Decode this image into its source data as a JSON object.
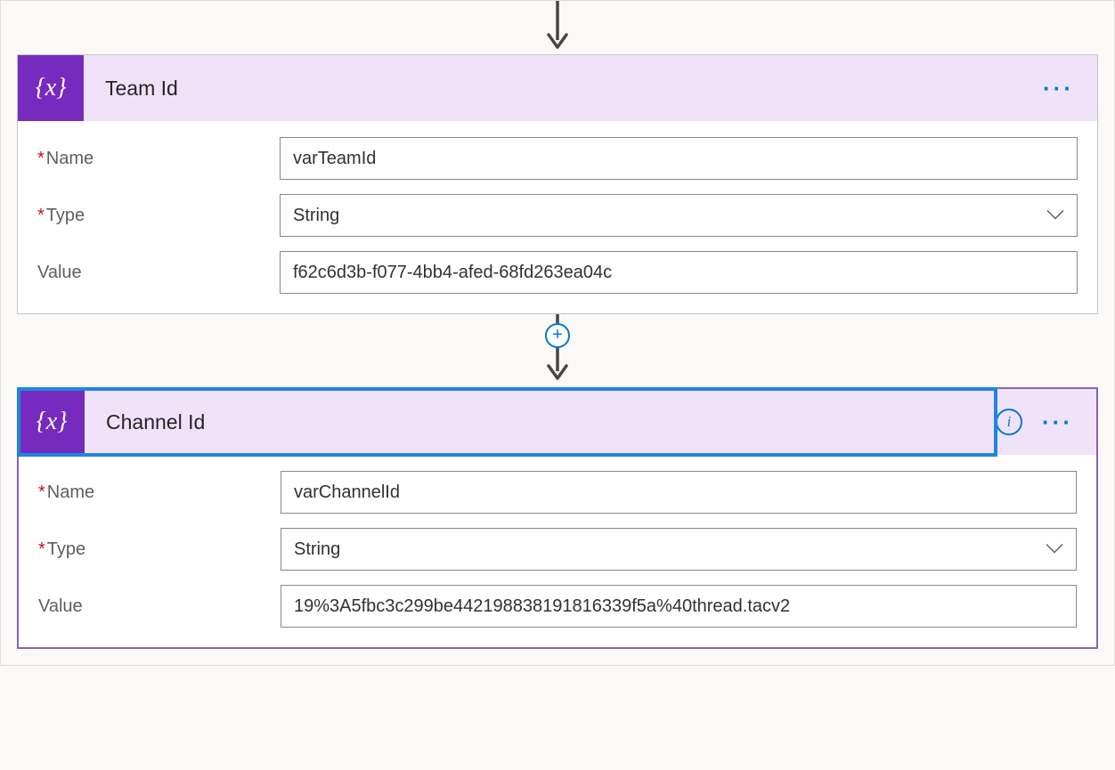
{
  "colors": {
    "iconBg": "#772bbe",
    "headerBg": "#f0e3f9",
    "accent": "#0078d4",
    "selectedBorder": "#8764b8",
    "selectedOutline": "#1f85e0"
  },
  "labels": {
    "name": "Name",
    "type": "Type",
    "value": "Value"
  },
  "actions": {
    "team": {
      "title": "Team Id",
      "fields": {
        "name": "varTeamId",
        "type": "String",
        "value": "f62c6d3b-f077-4bb4-afed-68fd263ea04c"
      }
    },
    "channel": {
      "title": "Channel Id",
      "fields": {
        "name": "varChannelId",
        "type": "String",
        "value": "19%3A5fbc3c299be442198838191816339f5a%40thread.tacv2"
      }
    }
  }
}
